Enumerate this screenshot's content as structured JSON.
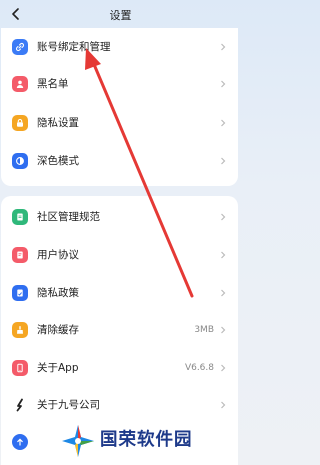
{
  "header": {
    "title": "设置"
  },
  "colors": {
    "accent_red": "#e53935",
    "brand_blue": "#1e3a8a"
  },
  "section1": {
    "items": [
      {
        "label": "账号绑定和管理",
        "icon": "link-icon",
        "color": "#3b7bf6"
      },
      {
        "label": "黑名单",
        "icon": "person-block-icon",
        "color": "#f45b69"
      },
      {
        "label": "隐私设置",
        "icon": "lock-icon",
        "color": "#f5a623"
      },
      {
        "label": "深色模式",
        "icon": "half-moon-icon",
        "color": "#2f6ef0"
      }
    ]
  },
  "section2": {
    "items": [
      {
        "label": "社区管理规范",
        "icon": "document-icon",
        "color": "#2fb87a"
      },
      {
        "label": "用户协议",
        "icon": "agreement-icon",
        "color": "#f45b69"
      },
      {
        "label": "隐私政策",
        "icon": "policy-icon",
        "color": "#2f6ef0"
      },
      {
        "label": "清除缓存",
        "icon": "broom-icon",
        "color": "#f5a623",
        "value": "3MB"
      },
      {
        "label": "关于App",
        "icon": "phone-icon",
        "color": "#f45b69",
        "value": "V6.6.8"
      },
      {
        "label": "关于九号公司",
        "icon": "ninebot-icon",
        "color": "#222222"
      },
      {
        "label": "",
        "icon": "upload-icon",
        "color": "#2f6ef0"
      }
    ]
  },
  "watermark": {
    "text": "国荣软件园"
  }
}
